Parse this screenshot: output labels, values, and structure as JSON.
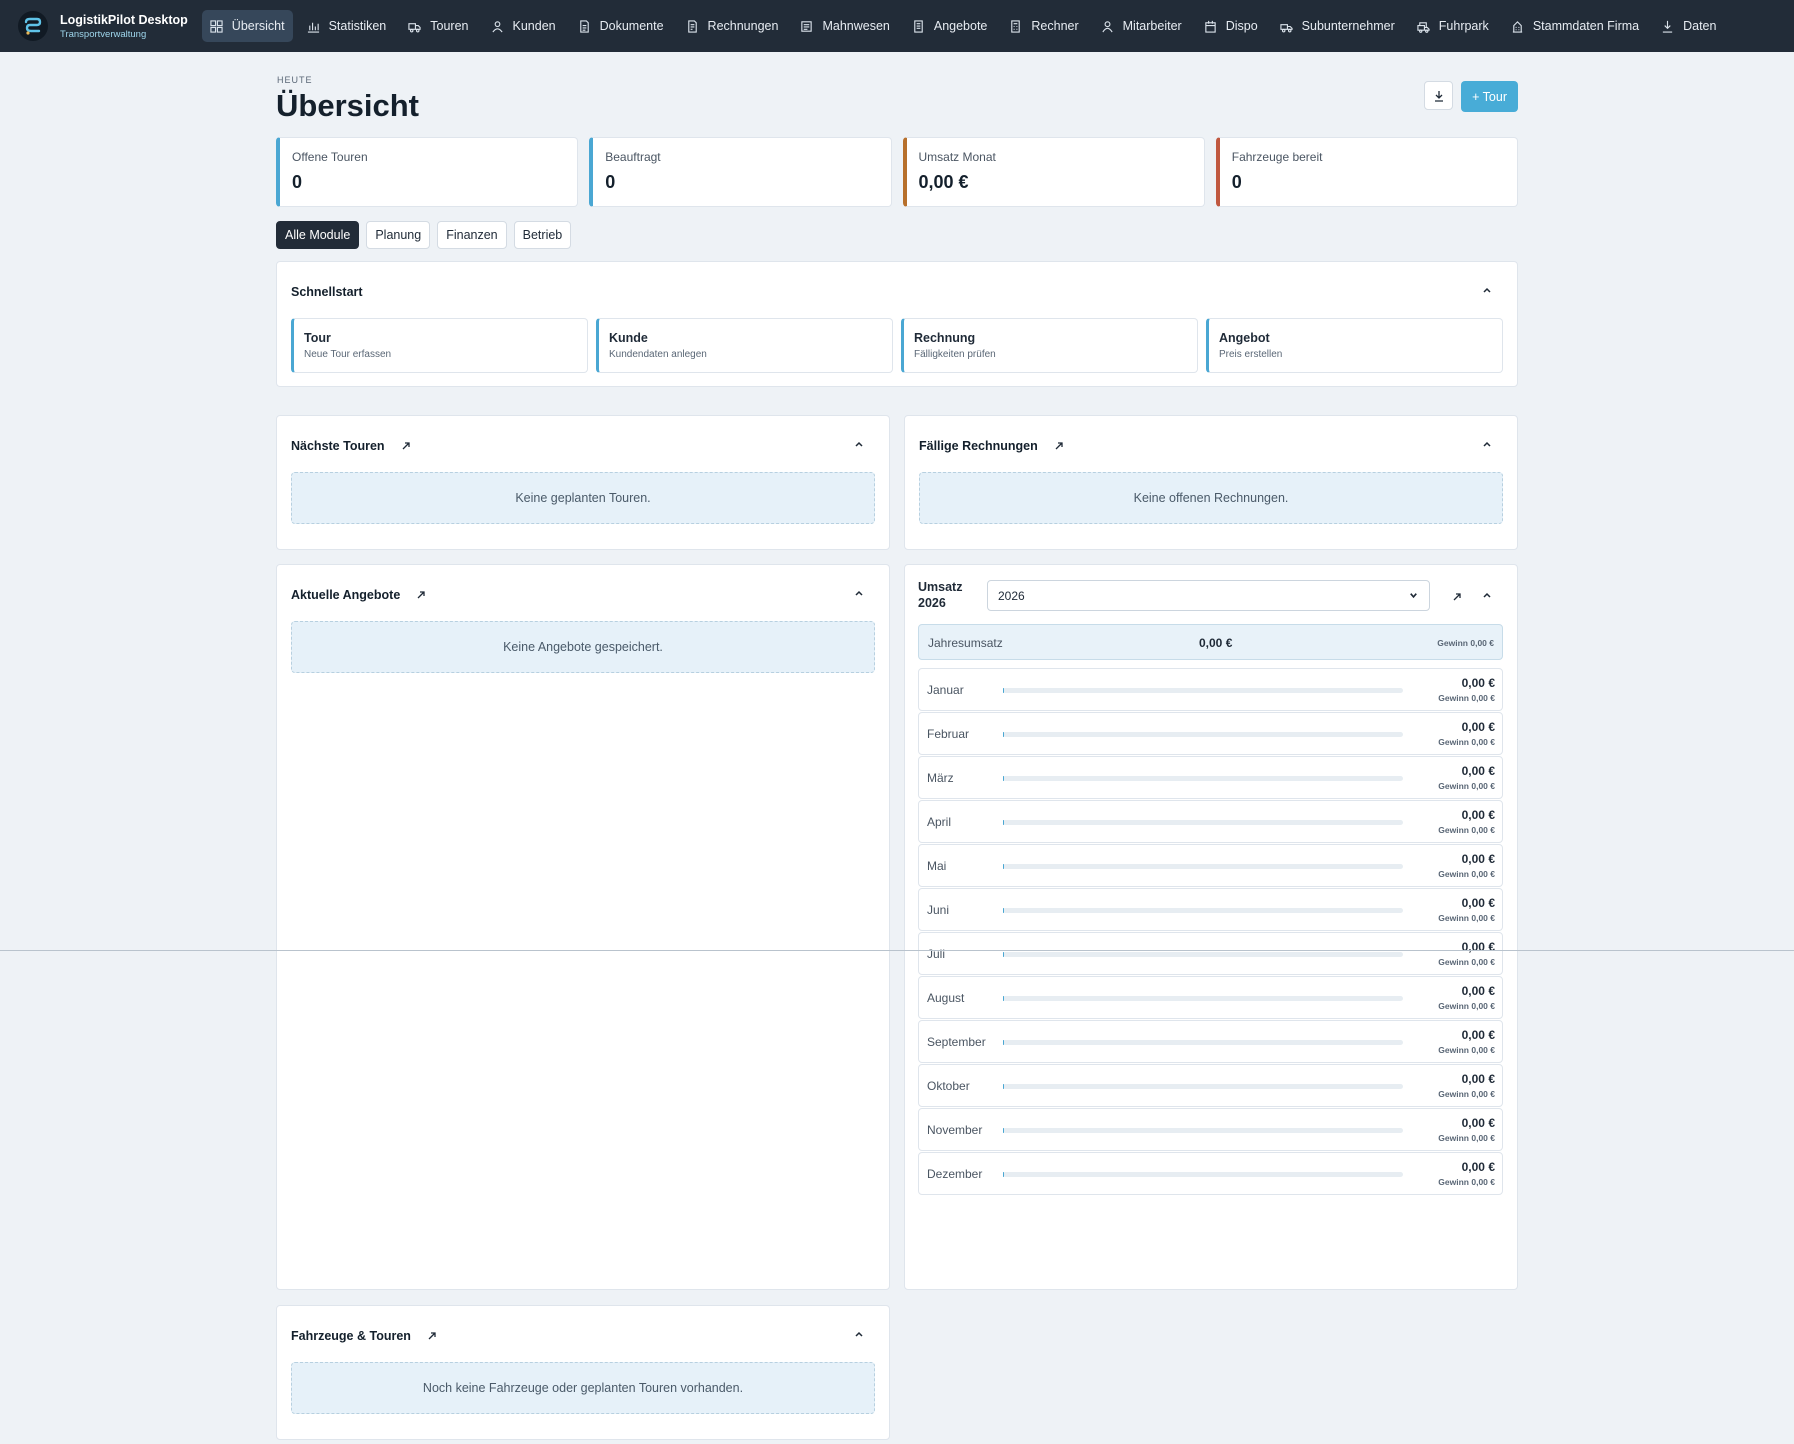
{
  "app": {
    "title": "LogistikPilot Desktop",
    "subtitle": "Transportverwaltung"
  },
  "nav": [
    {
      "label": "Übersicht",
      "icon": "dashboard-icon",
      "active": true
    },
    {
      "label": "Statistiken",
      "icon": "chart-icon"
    },
    {
      "label": "Touren",
      "icon": "truck-icon"
    },
    {
      "label": "Kunden",
      "icon": "user-icon"
    },
    {
      "label": "Dokumente",
      "icon": "document-icon"
    },
    {
      "label": "Rechnungen",
      "icon": "invoice-icon"
    },
    {
      "label": "Mahnwesen",
      "icon": "reminder-icon"
    },
    {
      "label": "Angebote",
      "icon": "offer-icon"
    },
    {
      "label": "Rechner",
      "icon": "calculator-icon"
    },
    {
      "label": "Mitarbeiter",
      "icon": "person-icon"
    },
    {
      "label": "Dispo",
      "icon": "calendar-icon"
    },
    {
      "label": "Subunternehmer",
      "icon": "subcontractor-icon"
    },
    {
      "label": "Fuhrpark",
      "icon": "fleet-icon"
    },
    {
      "label": "Stammdaten Firma",
      "icon": "building-icon"
    },
    {
      "label": "Daten",
      "icon": "download-icon"
    }
  ],
  "page": {
    "kicker": "HEUTE",
    "title": "Übersicht",
    "add_tour": "+ Tour"
  },
  "kpis": [
    {
      "label": "Offene Touren",
      "value": "0",
      "color": "#4aa7d3"
    },
    {
      "label": "Beauftragt",
      "value": "0",
      "color": "#4aa7d3"
    },
    {
      "label": "Umsatz Monat",
      "value": "0,00 €",
      "color": "#b7702c"
    },
    {
      "label": "Fahrzeuge bereit",
      "value": "0",
      "color": "#c0583f"
    }
  ],
  "filters": [
    {
      "label": "Alle Module",
      "active": true
    },
    {
      "label": "Planung"
    },
    {
      "label": "Finanzen"
    },
    {
      "label": "Betrieb"
    }
  ],
  "quickstart": {
    "title": "Schnellstart",
    "items": [
      {
        "title": "Tour",
        "sub": "Neue Tour erfassen"
      },
      {
        "title": "Kunde",
        "sub": "Kundendaten anlegen"
      },
      {
        "title": "Rechnung",
        "sub": "Fälligkeiten prüfen"
      },
      {
        "title": "Angebot",
        "sub": "Preis erstellen"
      }
    ]
  },
  "next_tours": {
    "title": "Nächste Touren",
    "empty": "Keine geplanten Touren."
  },
  "due_invoices": {
    "title": "Fällige Rechnungen",
    "empty": "Keine offenen Rechnungen."
  },
  "offers": {
    "title": "Aktuelle Angebote",
    "empty": "Keine Angebote gespeichert."
  },
  "vehicles": {
    "title": "Fahrzeuge & Touren",
    "empty": "Noch keine Fahrzeuge oder geplanten Touren vorhanden."
  },
  "revenue": {
    "title_line1": "Umsatz",
    "title_line2": "2026",
    "year": "2026",
    "total_label": "Jahresumsatz",
    "total_value": "0,00 €",
    "total_gain": "Gewinn 0,00 €",
    "months": [
      {
        "name": "Januar",
        "value": "0,00 €",
        "gain": "Gewinn 0,00 €",
        "fraction": 0
      },
      {
        "name": "Februar",
        "value": "0,00 €",
        "gain": "Gewinn 0,00 €",
        "fraction": 0
      },
      {
        "name": "März",
        "value": "0,00 €",
        "gain": "Gewinn 0,00 €",
        "fraction": 0
      },
      {
        "name": "April",
        "value": "0,00 €",
        "gain": "Gewinn 0,00 €",
        "fraction": 0
      },
      {
        "name": "Mai",
        "value": "0,00 €",
        "gain": "Gewinn 0,00 €",
        "fraction": 0
      },
      {
        "name": "Juni",
        "value": "0,00 €",
        "gain": "Gewinn 0,00 €",
        "fraction": 0
      },
      {
        "name": "Juli",
        "value": "0,00 €",
        "gain": "Gewinn 0,00 €",
        "fraction": 0
      },
      {
        "name": "August",
        "value": "0,00 €",
        "gain": "Gewinn 0,00 €",
        "fraction": 0
      },
      {
        "name": "September",
        "value": "0,00 €",
        "gain": "Gewinn 0,00 €",
        "fraction": 0
      },
      {
        "name": "Oktober",
        "value": "0,00 €",
        "gain": "Gewinn 0,00 €",
        "fraction": 0
      },
      {
        "name": "November",
        "value": "0,00 €",
        "gain": "Gewinn 0,00 €",
        "fraction": 0
      },
      {
        "name": "Dezember",
        "value": "0,00 €",
        "gain": "Gewinn 0,00 €",
        "fraction": 0
      }
    ]
  }
}
